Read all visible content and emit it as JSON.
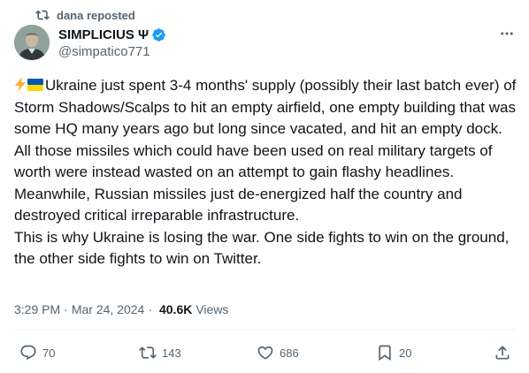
{
  "repost": {
    "label": "dana reposted",
    "icon": "repost-icon"
  },
  "author": {
    "display_name": "SIMPLICIUS Ψ",
    "handle": "@simpatico771",
    "verified_color": "#1d9bf0",
    "avatar": "avatar-portrait"
  },
  "tweet": {
    "lines": [
      "Ukraine just spent 3-4 months' supply (possibly their last batch ever) of Storm Shadows/Scalps to hit an empty airfield, one empty building that was some HQ many years ago but long since vacated, and hit an empty dock.",
      "All those missiles which could have been used on real military targets of worth were instead wasted on an attempt to gain flashy headlines.",
      "Meanwhile, Russian missiles just de-energized half the country and destroyed critical irreparable infrastructure.",
      "This is why Ukraine is losing the war. One side fights to win on the ground, the other side fights to win on Twitter."
    ]
  },
  "meta": {
    "time": "3:29 PM",
    "separator": "·",
    "date": "Mar 24, 2024",
    "views_count": "40.6K",
    "views_label": "Views"
  },
  "actions": {
    "replies": "70",
    "reposts": "143",
    "likes": "686",
    "bookmarks": "20"
  },
  "colors": {
    "text": "#0f1419",
    "secondary": "#536471",
    "divider": "#eff3f4",
    "flag_blue": "#0057b7",
    "flag_yellow": "#ffd700",
    "bolt": "#ffac33"
  }
}
